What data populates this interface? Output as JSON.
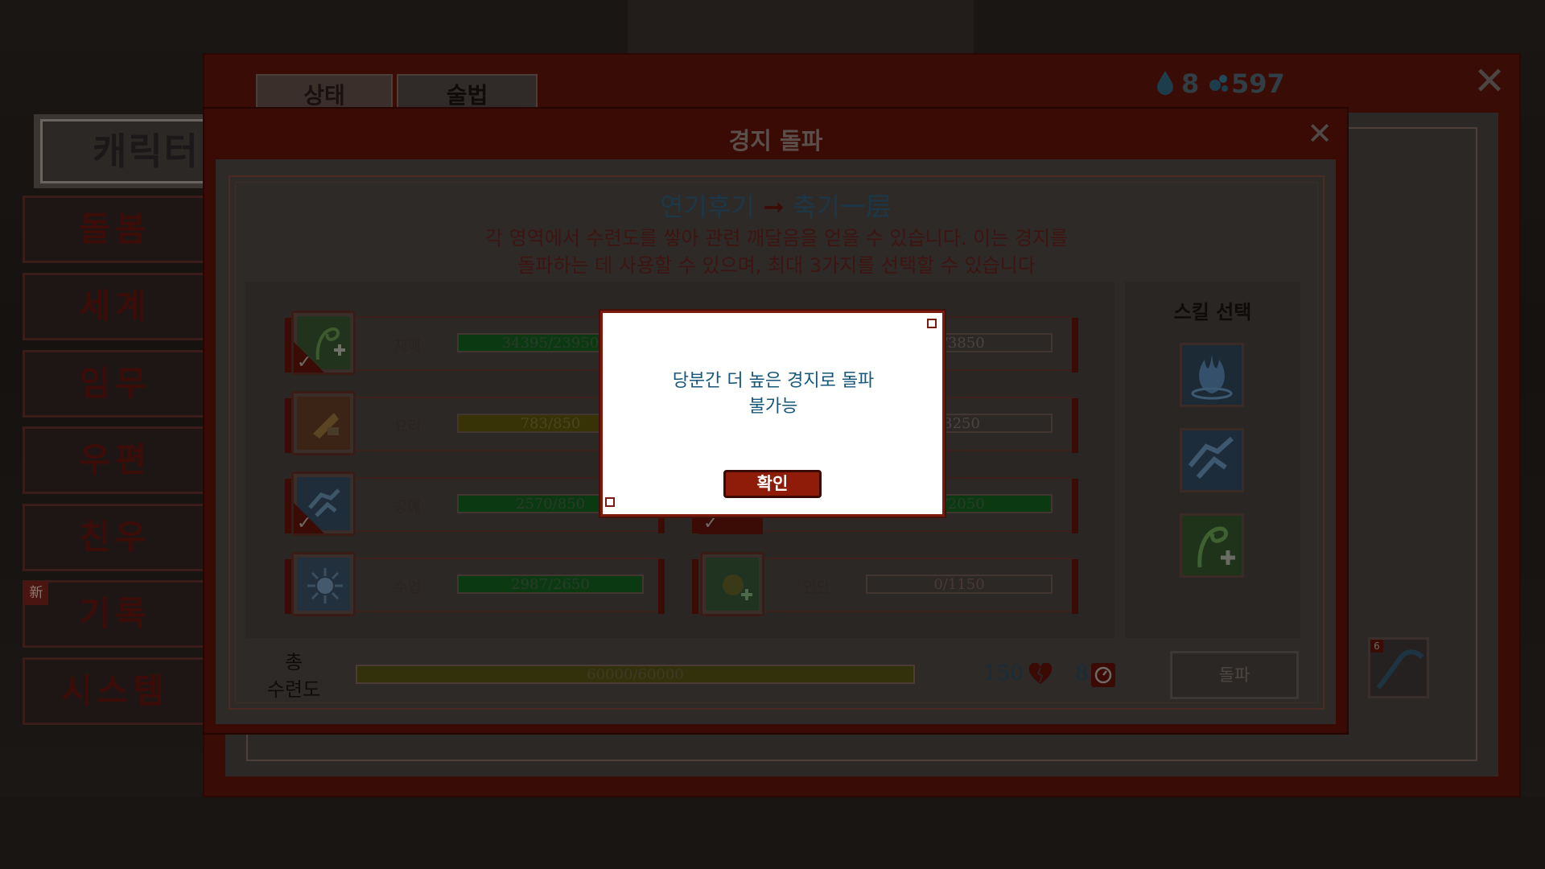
{
  "currency": {
    "water_icon": "water-drop-icon",
    "water_count": "8",
    "gem_icon": "spirit-gem-icon",
    "gem_count": "597"
  },
  "tabs": [
    {
      "label": "상태"
    },
    {
      "label": "술법"
    }
  ],
  "character": {
    "title": "캐릭터"
  },
  "sidebar": {
    "items": [
      {
        "label": "돌봄"
      },
      {
        "label": "세계"
      },
      {
        "label": "임무"
      },
      {
        "label": "우편"
      },
      {
        "label": "친우"
      },
      {
        "label": "기록",
        "badge": "新"
      },
      {
        "label": "시스템"
      }
    ]
  },
  "breakthrough": {
    "title": "경지 돌파",
    "from_realm": "연기후기",
    "to_realm": "축기一层",
    "description_line1": "각 영역에서 수련도를 쌓아 관련 깨달음을 얻을 수 있습니다. 이는 경지를",
    "description_line2": "돌파하는 데 사용할 수 있으며, 최대 3가지를 선택할 수 있습니다",
    "skills_left": [
      {
        "name": "재배",
        "progress": "34395/23950",
        "icon": "herb-plus-icon",
        "checked": true,
        "color": "#0b3a12"
      },
      {
        "name": "요리",
        "progress": "783/850",
        "icon": "cooking-icon",
        "checked": false,
        "color": "#383207"
      },
      {
        "name": "공예",
        "progress": "2570/850",
        "icon": "crafting-icon",
        "checked": true,
        "color": "#0b3a12"
      },
      {
        "name": "수업",
        "progress": "2987/2650",
        "icon": "teaching-icon",
        "checked": false,
        "color": "#0b3a12"
      }
    ],
    "skills_right": [
      {
        "name": "",
        "progress": "8/3850",
        "icon": "hidden-skill-icon",
        "checked": false,
        "color": ""
      },
      {
        "name": "",
        "progress": "/3250",
        "icon": "hidden-skill-icon",
        "checked": false,
        "color": ""
      },
      {
        "name": "",
        "progress": "5/2050",
        "icon": "hidden-skill-icon",
        "checked": true,
        "color": "#0b3a12"
      },
      {
        "name": "연단",
        "progress": "0/1150",
        "icon": "alchemy-icon",
        "checked": false,
        "color": ""
      }
    ],
    "select_title": "스킬 선택",
    "selected_icons": [
      "water-burst-icon",
      "crafting-icon",
      "herb-plus-icon"
    ],
    "total_label_1": "총",
    "total_label_2": "수련도",
    "total_progress": "60000/60000",
    "hp_cost": "150",
    "hp_icon": "broken-heart-icon",
    "time_cost": "8",
    "time_icon": "clock-icon",
    "break_button": "돌파"
  },
  "dialog": {
    "message_line1": "당분간 더 높은 경지로 돌파",
    "message_line2": "불가능",
    "confirm": "확인"
  },
  "inventory": {
    "item_count": "6"
  }
}
